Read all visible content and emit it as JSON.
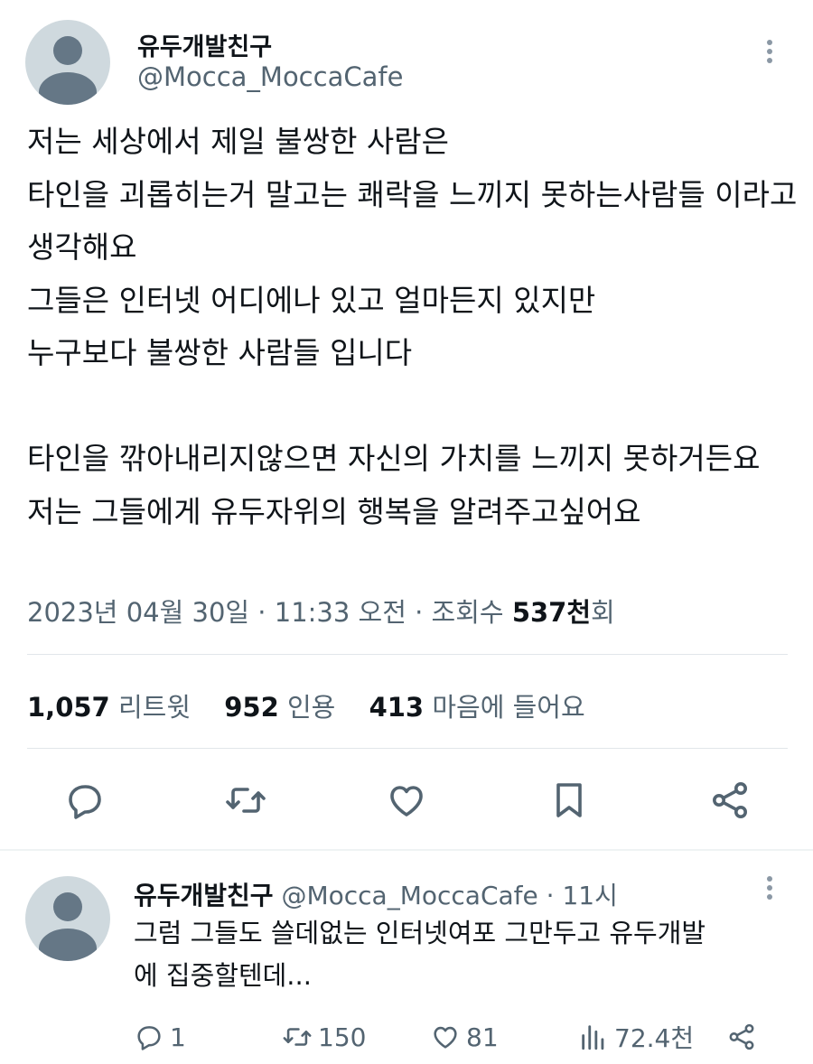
{
  "tweet": {
    "display_name": "유두개발친구",
    "handle": "@Mocca_MoccaCafe",
    "text": "저는 세상에서 제일 불쌍한 사람은\n타인을 괴롭히는거 말고는 쾌락을 느끼지 못하는사람들 이라고 생각해요\n그들은 인터넷 어디에나 있고 얼마든지 있지만\n누구보다 불쌍한 사람들 입니다\n\n타인을 깎아내리지않으면 자신의 가치를 느끼지 못하거든요\n저는 그들에게 유두자위의 행복을 알려주고싶어요",
    "timestamp": "2023년 04월 30일 · 11:33 오전 · 조회수",
    "views_number": "537천",
    "views_suffix": "회"
  },
  "stats": {
    "retweets_count": "1,057",
    "retweets_label": "리트윗",
    "quotes_count": "952",
    "quotes_label": "인용",
    "likes_count": "413",
    "likes_label": "마음에 들어요"
  },
  "icons": {
    "reply": "reply-icon",
    "retweet": "retweet-icon",
    "like": "heart-icon",
    "bookmark": "bookmark-icon",
    "share": "share-icon",
    "more": "more-vertical-icon",
    "views": "views-bar-chart-icon"
  },
  "reply": {
    "display_name": "유두개발친구",
    "handle": "@Mocca_MoccaCafe",
    "time": "· 11시",
    "text": "그럼 그들도 쓸데없는 인터넷여포 그만두고 유두개발\n에 집중할텐데...",
    "reply_count": "1",
    "retweet_count": "150",
    "like_count": "81",
    "view_count": "72.4천"
  },
  "colors": {
    "text": "#0f1419",
    "secondary": "#536471",
    "divider": "#e1e6ea",
    "avatar_bg": "#cfd9de"
  }
}
